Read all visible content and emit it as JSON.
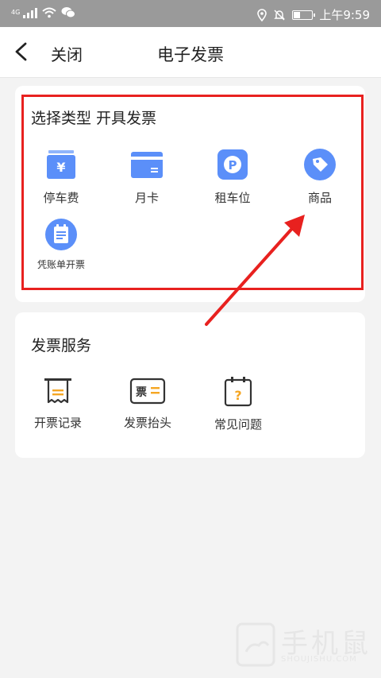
{
  "status_bar": {
    "network_label": "4G",
    "time": "上午9:59",
    "battery_level": 0.3
  },
  "nav": {
    "close_label": "关闭",
    "title": "电子发票"
  },
  "invoice_type_section": {
    "title": "选择类型 开具发票",
    "items": [
      {
        "label": "停车费",
        "icon": "yen-receipt-icon"
      },
      {
        "label": "月卡",
        "icon": "card-icon"
      },
      {
        "label": "租车位",
        "icon": "parking-p-icon"
      },
      {
        "label": "商品",
        "icon": "price-tag-icon"
      },
      {
        "label": "凭账单开票",
        "icon": "bill-document-icon"
      }
    ]
  },
  "invoice_service_section": {
    "title": "发票服务",
    "items": [
      {
        "label": "开票记录",
        "icon": "receipt-record-icon"
      },
      {
        "label": "发票抬头",
        "icon": "invoice-header-icon"
      },
      {
        "label": "常见问题",
        "icon": "faq-icon"
      }
    ]
  },
  "watermark": {
    "text": "手机鼠",
    "subtext": "SHOUJISHU.COM"
  },
  "colors": {
    "accent_blue": "#5b8ff9",
    "highlight_red": "#e8211f",
    "orange": "#f5a623"
  }
}
